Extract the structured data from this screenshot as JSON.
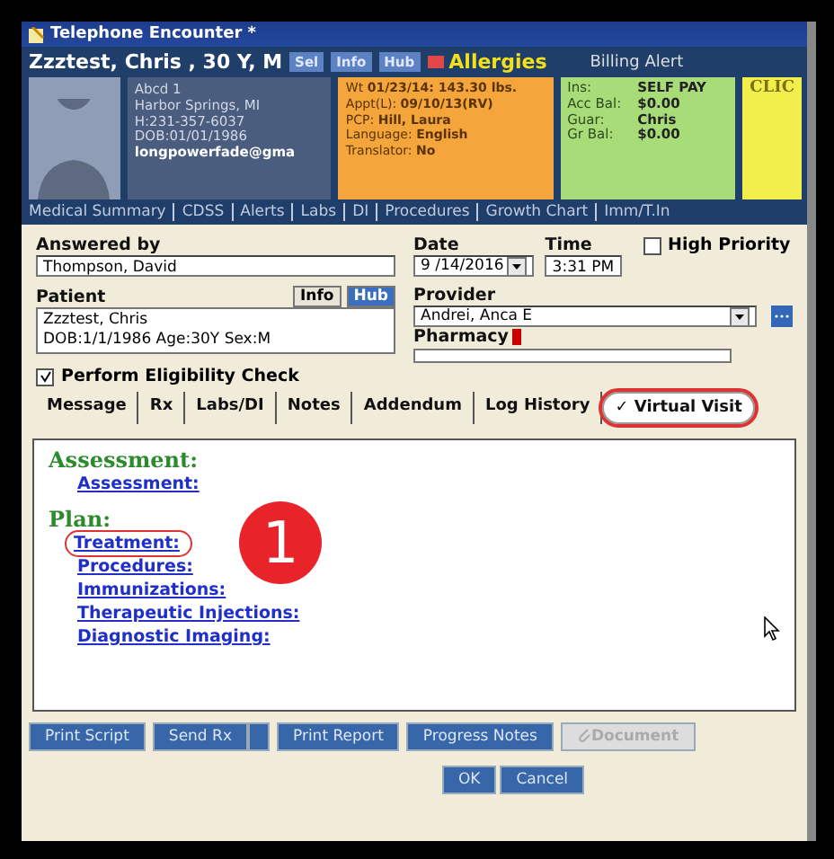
{
  "window": {
    "title": "Telephone Encounter *"
  },
  "patient_header": {
    "name": "Zzztest, Chris , 30 Y, M",
    "buttons": [
      "Sel",
      "Info",
      "Hub"
    ],
    "allergies": "Allergies",
    "billing_alert": "Billing Alert",
    "address": [
      "Abcd 1",
      "Harbor Springs, MI",
      "H:231-357-6037",
      "DOB:01/01/1986",
      "longpowerfade@gma"
    ],
    "clinical": [
      {
        "label": "Wt",
        "value": "01/23/14: 143.30 lbs."
      },
      {
        "label": "Appt(L):",
        "value": "09/10/13(RV)"
      },
      {
        "label": "PCP:",
        "value": "Hill, Laura"
      },
      {
        "label": "Language:",
        "value": "English"
      },
      {
        "label": "Translator:",
        "value": "No"
      }
    ],
    "billing": [
      {
        "label": "Ins:",
        "value": "SELF PAY"
      },
      {
        "label": "Acc Bal:",
        "value": "$0.00"
      },
      {
        "label": "Guar:",
        "value": "Chris"
      },
      {
        "label": "Gr Bal:",
        "value": "$0.00"
      }
    ],
    "extra_card": "CLIC"
  },
  "nav_links": [
    "Medical Summary",
    "CDSS",
    "Alerts",
    "Labs",
    "DI",
    "Procedures",
    "Growth Chart",
    "Imm/T.In"
  ],
  "form": {
    "answered_by": {
      "label": "Answered by",
      "value": "Thompson, David"
    },
    "date": {
      "label": "Date",
      "value": "9 /14/2016"
    },
    "time": {
      "label": "Time",
      "value": "3:31 PM"
    },
    "high_priority": {
      "label": "High Priority",
      "checked": false
    },
    "patient": {
      "label": "Patient",
      "buttons": [
        "Info",
        "Hub"
      ],
      "lines": [
        "Zzztest, Chris",
        "DOB:1/1/1986  Age:30Y  Sex:M"
      ]
    },
    "provider": {
      "label": "Provider",
      "value": "Andrei, Anca E"
    },
    "pharmacy": {
      "label": "Pharmacy"
    },
    "eligibility": {
      "label": "Perform Eligibility Check",
      "checked": true
    }
  },
  "tabs": [
    {
      "label": "Message",
      "selected": false,
      "highlighted": false
    },
    {
      "label": "Rx",
      "selected": false,
      "highlighted": false
    },
    {
      "label": "Labs/DI",
      "selected": false,
      "highlighted": false
    },
    {
      "label": "Notes",
      "selected": false,
      "highlighted": false
    },
    {
      "label": "Addendum",
      "selected": false,
      "highlighted": false
    },
    {
      "label": "Log History",
      "selected": false,
      "highlighted": false
    },
    {
      "label": "Virtual Visit",
      "mark": "✓",
      "selected": true,
      "highlighted": true
    }
  ],
  "sections": [
    {
      "heading": "Assessment:",
      "links": [
        {
          "label": "Assessment:",
          "highlighted": false
        }
      ]
    },
    {
      "heading": "Plan:",
      "links": [
        {
          "label": "Treatment:",
          "highlighted": true
        },
        {
          "label": "Procedures:",
          "highlighted": false
        },
        {
          "label": "Immunizations:",
          "highlighted": false
        },
        {
          "label": "Therapeutic Injections:",
          "highlighted": false
        },
        {
          "label": "Diagnostic Imaging:",
          "highlighted": false
        }
      ]
    }
  ],
  "callout": {
    "label": "1"
  },
  "buttons": [
    {
      "label": "Print Script",
      "kind": "plain",
      "disabled": false
    },
    {
      "label": "Send Rx",
      "kind": "split",
      "disabled": false
    },
    {
      "label": "Print Report",
      "kind": "plain",
      "disabled": false
    },
    {
      "label": "Progress Notes",
      "kind": "plain",
      "disabled": false
    },
    {
      "label": "Document",
      "kind": "attach",
      "disabled": true
    }
  ],
  "dialog_buttons": [
    "OK",
    "Cancel"
  ]
}
